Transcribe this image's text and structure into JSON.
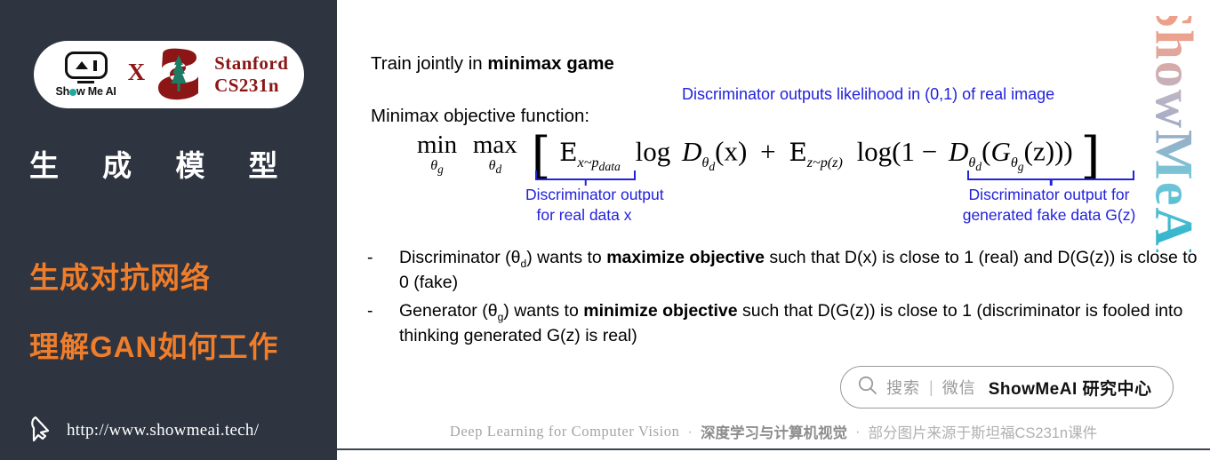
{
  "sidebar": {
    "logo": {
      "showmeai_label": "Show Me AI",
      "cross": "X",
      "stanford_line1": "Stanford",
      "stanford_line2": "CS231n",
      "stanford_color": "#8C1515"
    },
    "title": "生 成 模 型",
    "subtitle_1": "生成对抗网络",
    "subtitle_2": "理解GAN如何工作",
    "url": "http://www.showmeai.tech/",
    "accent_color": "#ef7d2a",
    "background_color": "#2e3440",
    "cursor_icon": "cursor-arrow-icon"
  },
  "main": {
    "heading_prefix": "Train jointly in ",
    "heading_bold": "minimax game",
    "objective_label": "Minimax objective function:",
    "blue_note_top": "Discriminator outputs likelihood in (0,1) of real image",
    "blue_caption_left_line1": "Discriminator output",
    "blue_caption_left_line2": "for real data x",
    "blue_caption_right_line1": "Discriminator output for",
    "blue_caption_right_line2": "generated fake data G(z)",
    "blue_color": "#2222dd",
    "formula": {
      "min_op": "min",
      "min_sub": "θ",
      "min_sub_idx": "g",
      "max_op": "max",
      "max_sub": "θ",
      "max_sub_idx": "d",
      "bracket_open": "[",
      "bracket_close": "]",
      "expect_1": "E",
      "expect_1_sub": "x~p",
      "expect_1_sub_idx": "data",
      "log_1": "log",
      "d_term": "D",
      "d_sub": "θ",
      "d_sub_idx": "d",
      "d_arg": "(x)",
      "plus": "+",
      "expect_2": "E",
      "expect_2_sub": "z~p(z)",
      "log_2": "log(1 −",
      "d_term2": "D",
      "g_term": "G",
      "g_sub": "θ",
      "g_sub_idx": "g",
      "g_arg": "(z)))",
      "latex": "min_{θ_g} max_{θ_d} [ E_{x~p_data} log D_{θ_d}(x) + E_{z~p(z)} log(1 − D_{θ_d}(G_{θ_g}(z))) ]"
    },
    "bullets": [
      {
        "marker": "-",
        "part1": "Discriminator (θ",
        "sub1": "d",
        "part2": ") wants to ",
        "bold": "maximize objective",
        "part3": " such that D(x) is close to 1 (real) and D(G(z)) is close to 0 (fake)"
      },
      {
        "marker": "-",
        "part1": "Generator (θ",
        "sub1": "g",
        "part2": ") wants to ",
        "bold": "minimize objective",
        "part3": " such that D(G(z)) is close to 1 (discriminator is fooled into thinking generated G(z) is real)"
      }
    ],
    "search_pill": {
      "icon": "search-icon",
      "text_gray": "搜索",
      "divider": "|",
      "text_gray2": "微信",
      "text_bold": "ShowMeAI 研究中心"
    },
    "watermark": "ShowMeAI"
  },
  "footer": {
    "english": "Deep Learning for Computer Vision",
    "dot_1": "·",
    "chinese_bold": "深度学习与计算机视觉",
    "dot_2": "·",
    "source": "部分图片来源于斯坦福CS231n课件"
  }
}
